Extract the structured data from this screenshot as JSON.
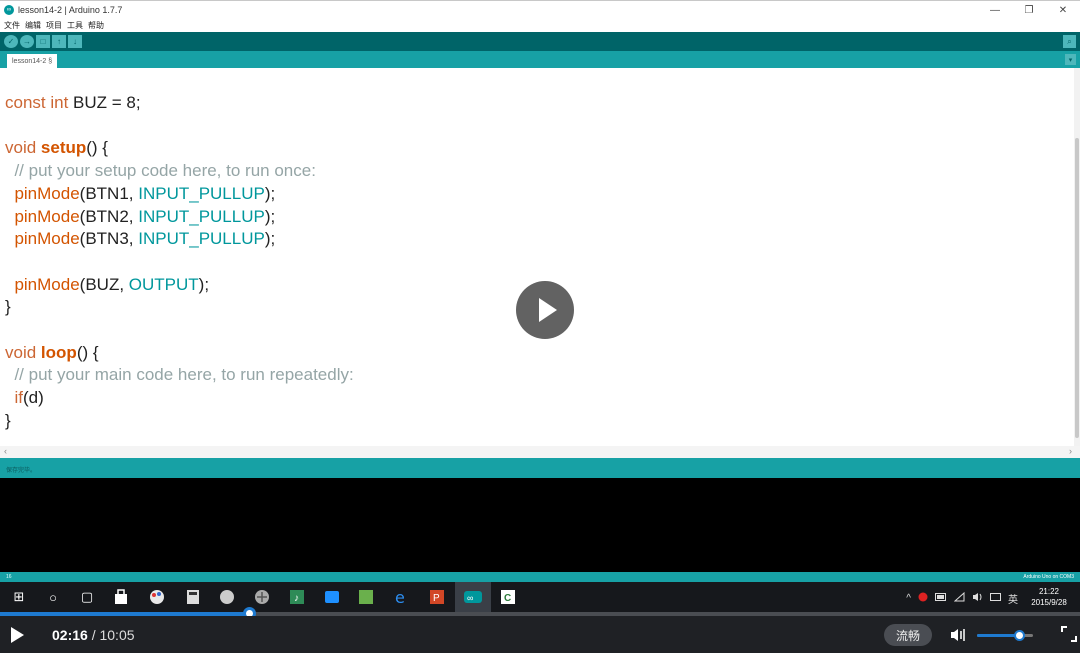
{
  "window": {
    "title": "lesson14-2 | Arduino 1.7.7",
    "minimize": "—",
    "restore": "❐",
    "close": "✕"
  },
  "menu": [
    "文件",
    "编辑",
    "项目",
    "工具",
    "帮助"
  ],
  "toolbar": {
    "verify": "✓",
    "upload": "→",
    "new": "□",
    "open": "↑",
    "save": "↓",
    "serial": "⌕"
  },
  "tab": {
    "label": "lesson14-2 §",
    "menu": "▾"
  },
  "code": {
    "l1_kw": "const int",
    "l1_rest": " BUZ = 8;",
    "l3_kw": "void ",
    "l3_fn": "setup",
    "l3_rest": "() {",
    "l4": "  // put your setup code here, to run once:",
    "l5_fn": "  pinMode",
    "l5_a": "(BTN1, ",
    "l5_c": "INPUT_PULLUP",
    "l5_b": ");",
    "l6_fn": "  pinMode",
    "l6_a": "(BTN2, ",
    "l6_c": "INPUT_PULLUP",
    "l6_b": ");",
    "l7_fn": "  pinMode",
    "l7_a": "(BTN3, ",
    "l7_c": "INPUT_PULLUP",
    "l7_b": ");",
    "l9_fn": "  pinMode",
    "l9_a": "(BUZ, ",
    "l9_c": "OUTPUT",
    "l9_b": ");",
    "l10": "}",
    "l12_kw": "void ",
    "l12_fn": "loop",
    "l12_rest": "() {",
    "l13": "  // put your main code here, to run repeatedly:",
    "l14_kw": "  if",
    "l14_rest": "(d)",
    "l15": "}"
  },
  "scroll": {
    "left": "‹",
    "right": "›"
  },
  "console": {
    "label": "保存完毕。"
  },
  "status": {
    "line": "16",
    "board": "Arduino Uno on COM3"
  },
  "taskbar": {
    "start": "⊞",
    "search": "○",
    "taskview": "▢",
    "tray_caret": "^",
    "ime": "英",
    "time": "21:22",
    "date": "2015/9/28"
  },
  "player": {
    "current": "02:16",
    "separator": " / ",
    "total": "10:05",
    "quality": "流畅",
    "progress": 0.231,
    "volume": 0.75
  }
}
